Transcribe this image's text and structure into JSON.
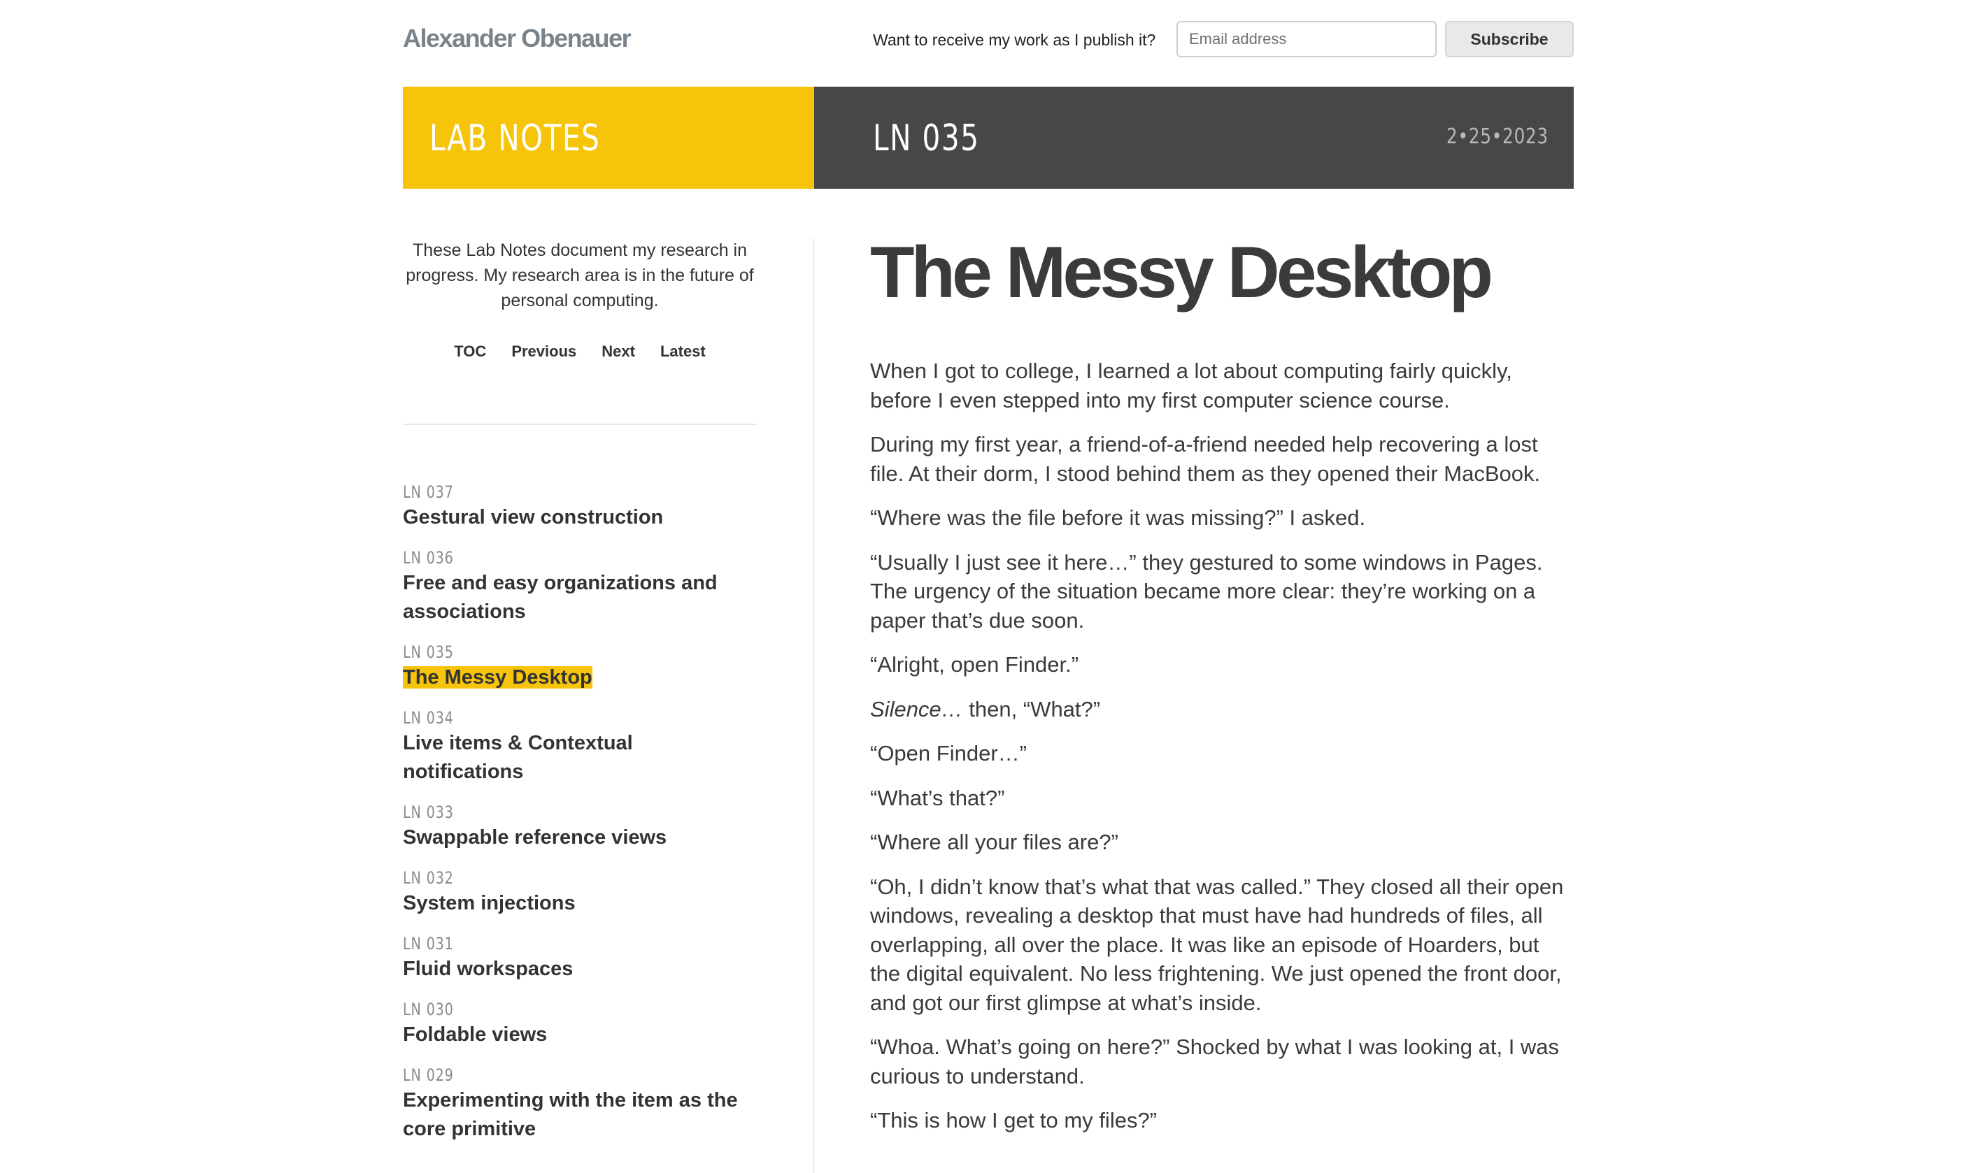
{
  "header": {
    "brand": "Alexander Obenauer",
    "subscribe_prompt": "Want to receive my work as I publish it?",
    "email_placeholder": "Email address",
    "subscribe_label": "Subscribe"
  },
  "banner": {
    "section": "LAB NOTES",
    "note_id": "LN 035",
    "date": "2•25•2023",
    "colors": {
      "section_bg": "#f6c50b",
      "note_bg": "#464749"
    }
  },
  "sidebar": {
    "intro": "These Lab Notes document my research in progress. My research area is in the future of personal computing.",
    "nav": [
      "TOC",
      "Previous",
      "Next",
      "Latest"
    ],
    "notes": [
      {
        "code": "LN 037",
        "title": "Gestural view construction"
      },
      {
        "code": "LN 036",
        "title": "Free and easy organizations and associations"
      },
      {
        "code": "LN 035",
        "title": "The Messy Desktop",
        "current": true
      },
      {
        "code": "LN 034",
        "title": "Live items & Contextual notifications"
      },
      {
        "code": "LN 033",
        "title": "Swappable reference views"
      },
      {
        "code": "LN 032",
        "title": "System injections"
      },
      {
        "code": "LN 031",
        "title": "Fluid workspaces"
      },
      {
        "code": "LN 030",
        "title": "Foldable views"
      },
      {
        "code": "LN 029",
        "title": "Experimenting with the item as the core primitive"
      }
    ]
  },
  "article": {
    "title": "The Messy Desktop",
    "paragraphs": [
      "When I got to college, I learned a lot about computing fairly quickly, before I even stepped into my first computer science course.",
      "During my first year, a friend-of-a-friend needed help recovering a lost file. At their dorm, I stood behind them as they opened their MacBook.",
      "“Where was the file before it was missing?” I asked.",
      "“Usually I just see it here…” they gestured to some windows in Pages. The urgency of the situation became more clear: they’re working on a paper that’s due soon.",
      "“Alright, open Finder.”",
      "“Open Finder…”",
      "“What’s that?”",
      "“Where all your files are?”",
      "“Oh, I didn’t know that’s what that was called.” They closed all their open windows, revealing a desktop that must have had hundreds of files, all overlapping, all over the place. It was like an episode of Hoarders, but the digital equivalent. No less frightening. We just opened the front door, and got our first glimpse at what’s inside.",
      "“Whoa. What’s going on here?” Shocked by what I was looking at, I was curious to understand.",
      "“This is how I get to my files?”"
    ],
    "silence": {
      "italic": "Silence…",
      "rest": " then, “What?”"
    }
  }
}
